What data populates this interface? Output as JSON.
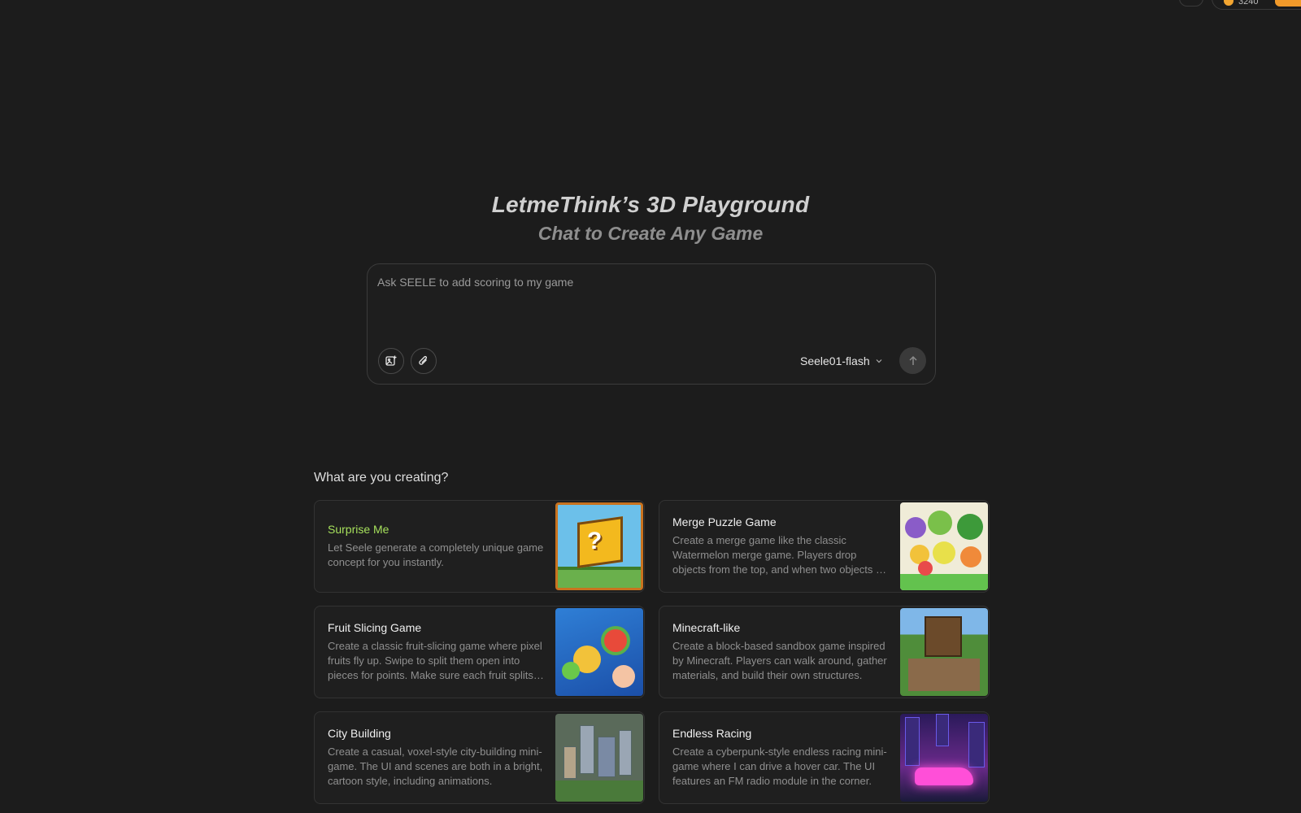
{
  "header": {
    "credits_value": "3240"
  },
  "hero": {
    "title": "LetmeThink’s 3D Playground",
    "subtitle": "Chat to Create Any Game"
  },
  "prompt": {
    "placeholder": "Ask SEELE to add scoring to my game",
    "value": "",
    "model": "Seele01-flash"
  },
  "templates": {
    "heading": "What are you creating?",
    "cards": [
      {
        "title": "Surprise Me",
        "description": "Let Seele generate a completely unique game concept for you instantly.",
        "thumbnail": "mystery-block-image"
      },
      {
        "title": "Merge Puzzle Game",
        "description": "Create a merge game like the classic Watermelon merge game. Players drop objects from the top, and when two objects of the same type touch, they merge.",
        "thumbnail": "fruit-merge-image"
      },
      {
        "title": "Fruit Slicing Game",
        "description": "Create a classic fruit-slicing game where pixel fruits fly up. Swipe to split them open into pieces for points. Make sure each fruit splits cleanly.",
        "thumbnail": "fruit-slicing-image"
      },
      {
        "title": "Minecraft-like",
        "description": "Create a block-based sandbox game inspired by Minecraft. Players can walk around, gather materials, and build their own structures.",
        "thumbnail": "voxel-world-image"
      },
      {
        "title": "City Building",
        "description": "Create a casual, voxel-style city-building mini-game. The UI and scenes are both in a bright, cartoon style, including animations.",
        "thumbnail": "city-map-image"
      },
      {
        "title": "Endless Racing",
        "description": "Create a cyberpunk-style endless racing mini-game where I can drive a hover car. The UI features an FM radio module in the corner.",
        "thumbnail": "neon-car-image"
      }
    ]
  },
  "colors": {
    "background": "#1c1c1c",
    "accent_green": "#a6e05c",
    "coin": "#f2a531"
  }
}
